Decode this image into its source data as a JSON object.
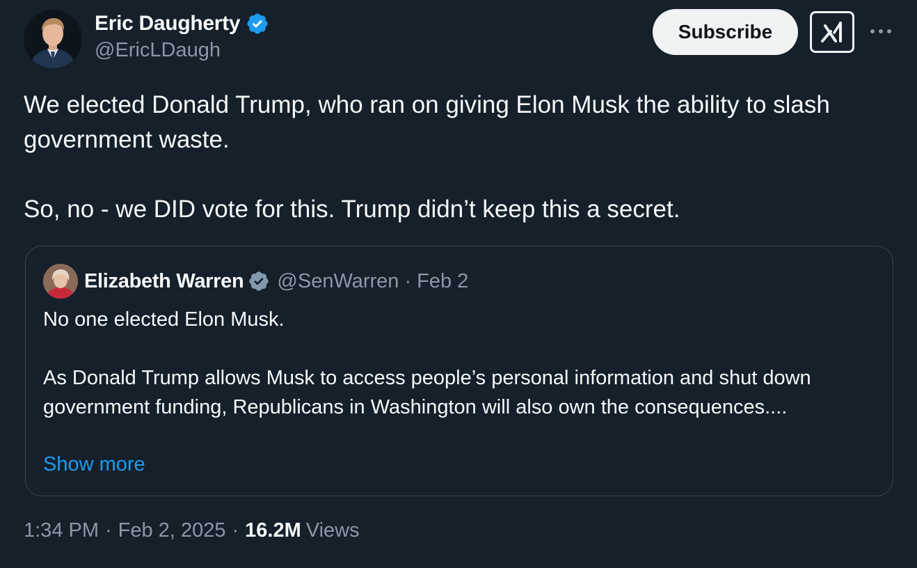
{
  "author": {
    "name": "Eric Daugherty",
    "handle": "@EricLDaugh",
    "verified": true,
    "verified_color": "#1d9bf0"
  },
  "actions": {
    "subscribe_label": "Subscribe",
    "grok_icon": "grok-icon",
    "more_icon": "more-horizontal-icon"
  },
  "tweet": {
    "text": "We elected Donald Trump, who ran on giving Elon Musk the ability to slash government waste.\n\nSo, no - we DID vote for this. Trump didn’t keep this a secret."
  },
  "quoted_tweet": {
    "name": "Elizabeth Warren",
    "handle": "@SenWarren",
    "separator": "·",
    "date": "Feb 2",
    "verified": true,
    "verified_color": "#829aab",
    "text": "No one elected Elon Musk.\n\nAs Donald Trump allows Musk to access people’s personal information and shut down government funding, Republicans in Washington will also own the consequences....",
    "show_more_label": "Show more"
  },
  "meta": {
    "time": "1:34 PM",
    "separator": "·",
    "date": "Feb 2, 2025",
    "views_count": "16.2M",
    "views_label": "Views"
  },
  "colors": {
    "background": "#15202b",
    "text_primary": "#f7f9f9",
    "text_secondary": "#8b98a5",
    "link": "#1d9bf0",
    "border": "#38444d"
  }
}
